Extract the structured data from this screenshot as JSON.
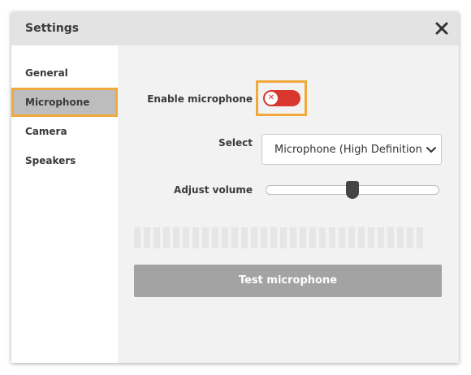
{
  "dialog": {
    "title": "Settings",
    "close_icon": "close-icon"
  },
  "sidebar": {
    "items": [
      {
        "label": "General",
        "active": false
      },
      {
        "label": "Microphone",
        "active": true
      },
      {
        "label": "Camera",
        "active": false
      },
      {
        "label": "Speakers",
        "active": false
      }
    ]
  },
  "microphone": {
    "enable_label": "Enable microphone",
    "enabled": false,
    "toggle_icon": "x-icon",
    "select_label": "Select",
    "select_value": "Microphone (High Definition Audio Device)",
    "volume_label": "Adjust volume",
    "volume_fraction": 0.5,
    "meter_segments": 30,
    "test_label": "Test microphone"
  },
  "colors": {
    "highlight": "#f2a93b",
    "toggle_off": "#d8372e",
    "button_disabled": "#a3a3a3",
    "header_bg": "#e3e3e3",
    "active_item_bg": "#bdbdbd"
  }
}
